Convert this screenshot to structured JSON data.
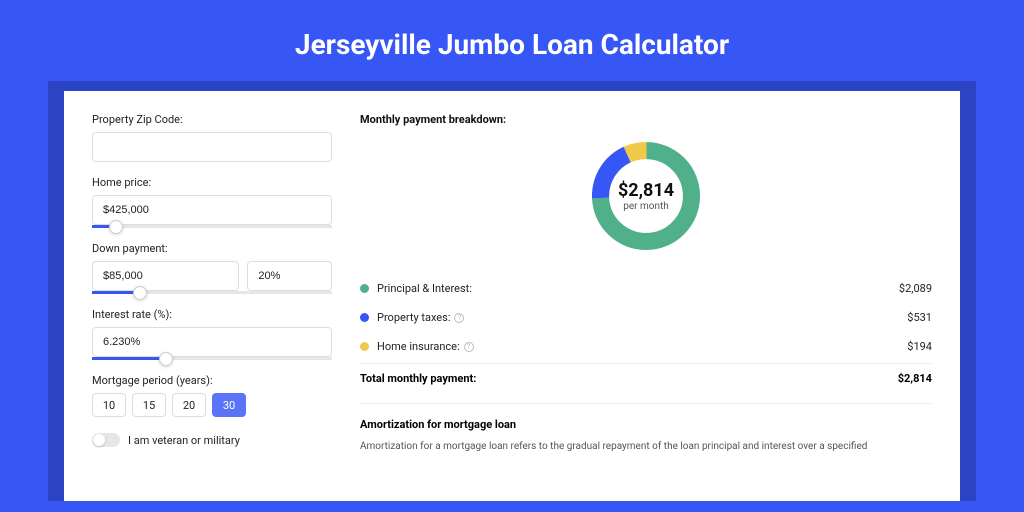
{
  "title": "Jerseyville Jumbo Loan Calculator",
  "form": {
    "zip_label": "Property Zip Code:",
    "zip_value": "",
    "price_label": "Home price:",
    "price_value": "$425,000",
    "down_label": "Down payment:",
    "down_value": "$85,000",
    "down_pct": "20%",
    "rate_label": "Interest rate (%):",
    "rate_value": "6.230%",
    "period_label": "Mortgage period (years):",
    "periods": [
      "10",
      "15",
      "20",
      "30"
    ],
    "period_selected": "30",
    "veteran_label": "I am veteran or military"
  },
  "breakdown": {
    "title": "Monthly payment breakdown:",
    "total_amount": "$2,814",
    "per_month": "per month",
    "items": [
      {
        "label": "Principal & Interest:",
        "value": "$2,089",
        "color": "green"
      },
      {
        "label": "Property taxes:",
        "value": "$531",
        "color": "blue",
        "info": true
      },
      {
        "label": "Home insurance:",
        "value": "$194",
        "color": "yellow",
        "info": true
      }
    ],
    "total_label": "Total monthly payment:",
    "total_value": "$2,814"
  },
  "amort": {
    "title": "Amortization for mortgage loan",
    "text": "Amortization for a mortgage loan refers to the gradual repayment of the loan principal and interest over a specified"
  },
  "chart_data": {
    "type": "pie",
    "title": "Monthly payment breakdown",
    "series": [
      {
        "name": "Principal & Interest",
        "value": 2089,
        "color": "#4fb08a"
      },
      {
        "name": "Property taxes",
        "value": 531,
        "color": "#3656f5"
      },
      {
        "name": "Home insurance",
        "value": 194,
        "color": "#f0c94a"
      }
    ],
    "total": 2814
  }
}
